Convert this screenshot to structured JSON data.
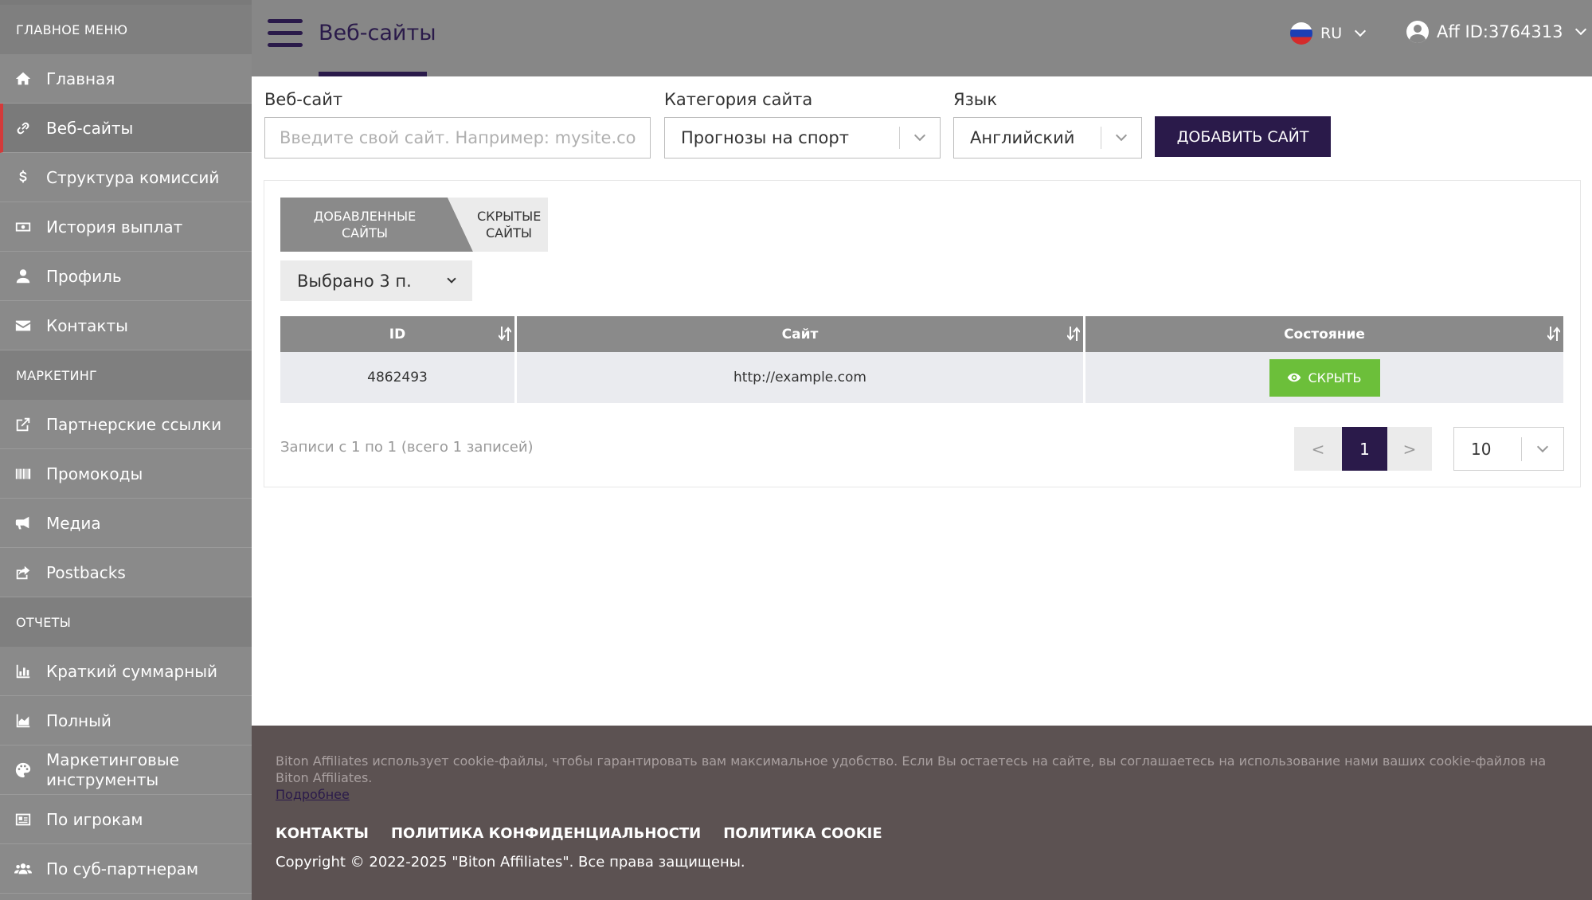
{
  "sidebar": {
    "main_menu_label": "Главное меню",
    "main_items": [
      {
        "label": "Главная",
        "icon": "home-icon"
      },
      {
        "label": "Веб-сайты",
        "icon": "link-icon",
        "active": true
      },
      {
        "label": "Структура комиссий",
        "icon": "dollar-icon"
      },
      {
        "label": "История выплат",
        "icon": "money-icon"
      },
      {
        "label": "Профиль",
        "icon": "user-icon"
      },
      {
        "label": "Контакты",
        "icon": "envelope-icon"
      }
    ],
    "marketing_label": "Маркетинг",
    "marketing_items": [
      {
        "label": "Партнерские ссылки",
        "icon": "external-link-icon"
      },
      {
        "label": "Промокоды",
        "icon": "barcode-icon"
      },
      {
        "label": "Медиа",
        "icon": "megaphone-icon"
      },
      {
        "label": "Postbacks",
        "icon": "share-icon"
      }
    ],
    "reports_label": "Отчеты",
    "reports_items": [
      {
        "label": "Краткий суммарный",
        "icon": "bar-chart-icon"
      },
      {
        "label": "Полный",
        "icon": "area-chart-icon"
      },
      {
        "label": "Маркетинговые инструменты",
        "icon": "palette-icon"
      },
      {
        "label": "По игрокам",
        "icon": "id-card-icon"
      },
      {
        "label": "По суб-партнерам",
        "icon": "users-icon"
      }
    ]
  },
  "header": {
    "title": "Веб-сайты",
    "language": "RU",
    "affiliate": "Aff ID:3764313"
  },
  "form": {
    "website_label": "Веб-сайт",
    "website_placeholder": "Введите свой сайт. Например: mysite.com",
    "category_label": "Категория сайта",
    "category_value": "Прогнозы на спорт",
    "language_label": "Язык",
    "language_value": "Английский",
    "add_button": "Добавить сайт"
  },
  "tabs": {
    "added": "Добавленные сайты",
    "hidden": "Скрытые сайты"
  },
  "selected_filter": "Выбрано 3 п.",
  "table": {
    "columns": [
      "ID",
      "Сайт",
      "Состояние"
    ],
    "rows": [
      {
        "id": "4862493",
        "site": "http://example.com",
        "action": "Скрыть"
      }
    ]
  },
  "pagination": {
    "records_text": "Записи с 1 по 1 (всего 1 записей)",
    "prev": "<",
    "current": "1",
    "next": ">",
    "per_page": "10"
  },
  "footer": {
    "cookie_text": "Biton Affiliates использует cookie-файлы, чтобы гарантировать вам максимальное удобство. Если Вы остаетесь на сайте, вы соглашаетесь на использование нами ваших cookie-файлов на Biton Affiliates.",
    "cookie_link": "Подробнее",
    "links": [
      "Контакты",
      "Политика конфиденциальности",
      "Политика cookie"
    ],
    "copyright": "Copyright © 2022-2025 \"Biton Affiliates\". Все права защищены."
  },
  "colors": {
    "brand": "#2a1a4a",
    "active_marker": "#d33a3a",
    "hide_button": "#6cbf3a",
    "sidebar": "#8a8a8a",
    "footer": "#5c5252"
  }
}
